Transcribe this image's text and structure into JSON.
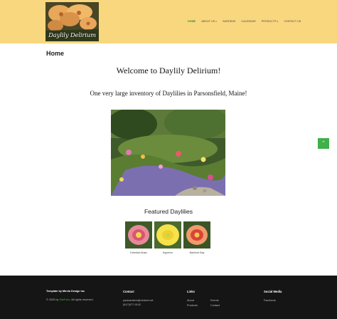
{
  "header": {
    "logo_text": "Daylily Delirium",
    "nav": [
      {
        "label": "HOME",
        "active": true,
        "dropdown": false
      },
      {
        "label": "ABOUT US",
        "active": false,
        "dropdown": true
      },
      {
        "label": "GARDENS",
        "active": false,
        "dropdown": false
      },
      {
        "label": "CALENDAR",
        "active": false,
        "dropdown": false
      },
      {
        "label": "PRODUCTS",
        "active": false,
        "dropdown": true
      },
      {
        "label": "CONTACT US",
        "active": false,
        "dropdown": false
      }
    ],
    "caret": "▾",
    "colors": {
      "background": "#f9d77e",
      "active": "#2e8b2e"
    }
  },
  "page": {
    "title": "Home",
    "welcome": "Welcome to Daylily Delirium!",
    "tagline": "One very large inventory of Daylilies in Parsonsfield, Maine!",
    "featured_title": "Featured Daylilies",
    "featured": [
      {
        "caption": "Celestial Music"
      },
      {
        "caption": "Hyperion"
      },
      {
        "caption": "Barefoot Bay"
      }
    ]
  },
  "back_to_top": {
    "icon": "chevron-up-icon",
    "glyph": "⌃",
    "color": "#3fb04a"
  },
  "footer": {
    "template_credit": "Template by Mirela Design Inc",
    "copyright_prefix": "© 2020 by",
    "copyright_brand": "SiteFolio",
    "copyright_suffix": ". All rights reserved.",
    "contact": {
      "heading": "Contact",
      "email": "paulsanders@netsert.net",
      "phone": "(617)977-9142"
    },
    "links": {
      "heading": "Links",
      "items": [
        "About",
        "Events",
        "Products",
        "Contact"
      ]
    },
    "social": {
      "heading": "Social Media",
      "items": [
        "Facebook"
      ]
    },
    "colors": {
      "background": "#151515",
      "accent": "#3fb04a"
    }
  }
}
